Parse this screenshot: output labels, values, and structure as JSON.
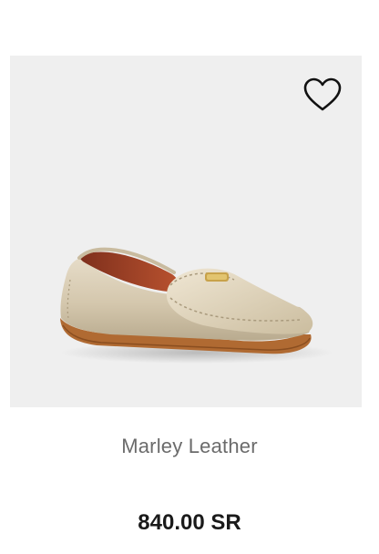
{
  "product": {
    "name": "Marley Leather",
    "price": "840.00 SR",
    "image_alt": "Marley Leather loafer in metallic champagne",
    "wishlist_icon": "heart-outline-icon"
  },
  "colors": {
    "panel_background": "#efefef",
    "name_text": "#6b6b6b",
    "price_text": "#1a1a1a",
    "shoe_leather": "#d8ccb6",
    "shoe_lining": "#a8462a",
    "sole": "#b06a32",
    "hardware": "#c8a24a"
  }
}
